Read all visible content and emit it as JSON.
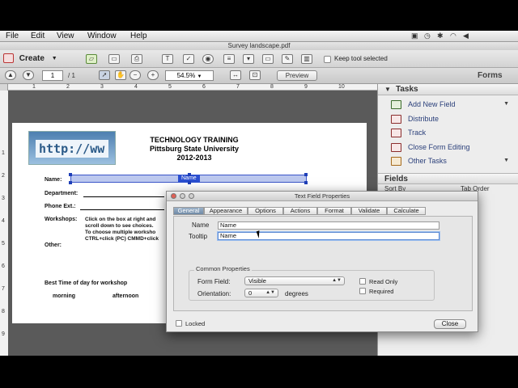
{
  "menubar": {
    "items": [
      "File",
      "Edit",
      "View",
      "Window",
      "Help"
    ],
    "right_icons": [
      "dropbox-icon",
      "clock-icon",
      "bluetooth-icon",
      "wifi-icon",
      "volume-icon"
    ]
  },
  "window": {
    "title": "Survey landscape.pdf"
  },
  "toolbar": {
    "create_label": "Create",
    "keep_tool_label": "Keep tool selected"
  },
  "nav": {
    "page_current": "1",
    "page_total": "/ 1",
    "zoom": "54.5%",
    "preview_label": "Preview",
    "mode_label": "Forms"
  },
  "rulers": {
    "top": [
      "1",
      "2",
      "3",
      "4",
      "5",
      "6",
      "7",
      "8",
      "9",
      "10"
    ],
    "left": [
      "1",
      "2",
      "3",
      "4",
      "5",
      "6",
      "7",
      "8",
      "9"
    ]
  },
  "document": {
    "logo_text": "http://ww",
    "title_line1": "TECHNOLOGY TRAINING",
    "title_line2": "Pittsburg State University",
    "title_line3": "2012-2013",
    "name_label": "Name:",
    "name_field_tag": "Name",
    "department_label": "Department:",
    "phone_label": "Phone Ext.:",
    "workshops_label": "Workshops:",
    "workshops_line1": "Click on the box at right and",
    "workshops_line2": "scroll down to see choices.",
    "workshops_line3": "To choose multiple worksho",
    "workshops_line4": "CTRL+click (PC) CMMD+click",
    "other_label": "Other:",
    "best_time_label": "Best Time of day for workshop",
    "morning_label": "morning",
    "afternoon_label": "afternoon"
  },
  "right_panel": {
    "tasks_header": "Tasks",
    "tasks": [
      {
        "label": "Add New Field",
        "has_dropdown": true
      },
      {
        "label": "Distribute",
        "has_dropdown": false
      },
      {
        "label": "Track",
        "has_dropdown": false
      },
      {
        "label": "Close Form Editing",
        "has_dropdown": false
      },
      {
        "label": "Other Tasks",
        "has_dropdown": true
      }
    ],
    "fields_header": "Fields",
    "sort_by": "Sort By",
    "tab_order": "Tab Order"
  },
  "dialog": {
    "title": "Text Field Properties",
    "tabs": [
      "General",
      "Appearance",
      "Options",
      "Actions",
      "Format",
      "Validate",
      "Calculate"
    ],
    "active_tab": "General",
    "name_label": "Name",
    "name_value": "Name",
    "tooltip_label": "Tooltip",
    "tooltip_value": "Name",
    "common_properties": "Common Properties",
    "form_field_label": "Form Field:",
    "form_field_value": "Visible",
    "orientation_label": "Orientation:",
    "orientation_value": "0",
    "degrees_label": "degrees",
    "read_only_label": "Read Only",
    "required_label": "Required",
    "locked_label": "Locked",
    "close_label": "Close"
  }
}
